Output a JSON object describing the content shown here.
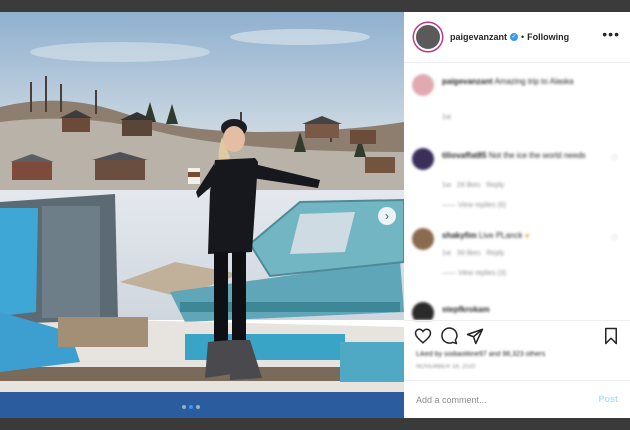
{
  "post": {
    "username": "paigevanzant",
    "verified": true,
    "follow_status": "Following",
    "more_icon": "ellipsis-icon"
  },
  "carousel": {
    "current_index": 1,
    "total": 3
  },
  "comments_area": {
    "caption": {
      "username": "paigevanzant",
      "text": "Amazing trip to Alaska",
      "time": "1w"
    },
    "comments": [
      {
        "username": "tiliovaffat85",
        "text": "Not the ice the world needs",
        "time": "1w",
        "likes": "28 likes",
        "reply": "Reply",
        "view_replies": "View replies (6)",
        "avatar_color": "#3a2f5a"
      },
      {
        "username": "shakyfim",
        "text": "Live PLanck",
        "time": "1w",
        "likes": "39 likes",
        "reply": "Reply",
        "view_replies": "View replies (3)",
        "avatar_color": "#8b6b4f"
      },
      {
        "username": "stepfkrokam",
        "text": "",
        "time": "",
        "likes": "",
        "reply": "",
        "view_replies": "",
        "avatar_color": "#2a2a2a"
      }
    ]
  },
  "actions": {
    "like_icon": "heart-icon",
    "comment_icon": "comment-icon",
    "share_icon": "share-icon",
    "save_icon": "bookmark-icon",
    "liked_by": "Liked by sodiaolitine97 and 98,323 others",
    "date": "NOVEMBER 18, 2020"
  },
  "comment_box": {
    "placeholder": "Add a comment...",
    "post_label": "Post"
  },
  "colors": {
    "accent": "#3897f0",
    "post_disabled": "#b2dffc",
    "story_ring": "#c13584"
  }
}
